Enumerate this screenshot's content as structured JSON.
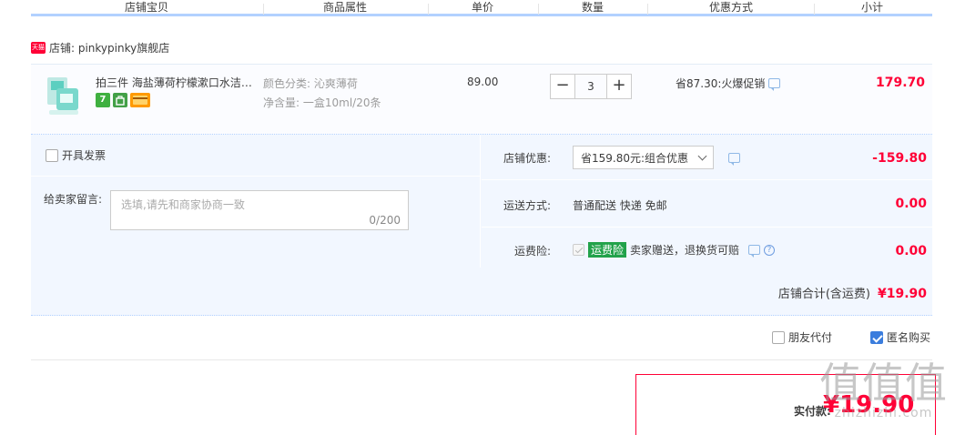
{
  "columns": {
    "shop_item": "店铺宝贝",
    "attributes": "商品属性",
    "unit_price": "单价",
    "quantity": "数量",
    "discount": "优惠方式",
    "subtotal": "小计"
  },
  "shop": {
    "badge": "天猫",
    "label": "店铺: pinkypinky旗舰店"
  },
  "item": {
    "title": "拍三件 海盐薄荷柠檬漱口水洁…",
    "tags": [
      "7",
      "",
      ""
    ],
    "attr_color": "颜色分类: 沁爽薄荷",
    "attr_content": "净含量: 一盒10ml/20条",
    "price": "89.00",
    "quantity": "3",
    "minus": "−",
    "plus": "+",
    "promo": "省87.30:火爆促销",
    "subtotal": "179.70"
  },
  "order": {
    "invoice_label": "开具发票",
    "memo_label": "给卖家留言:",
    "memo_placeholder": "选填,请先和商家协商一致",
    "memo_count": "0/200",
    "shop_discount_label": "店铺优惠:",
    "shop_discount_value": "省159.80元:组合优惠",
    "shop_discount_amount": "-159.80",
    "shipping_label": "运送方式:",
    "shipping_value": "普通配送 快递 免邮",
    "shipping_amount": "0.00",
    "insurance_label": "运费险:",
    "insurance_badge": "运费险",
    "insurance_value": "卖家赠送，退换货可赔",
    "insurance_amount": "0.00",
    "help_mark": "?",
    "total_label": "店铺合计(含运费)",
    "total_value": "¥19.90"
  },
  "options": {
    "friend_pay": "朋友代付",
    "anonymous": "匿名购买",
    "anonymous_checked": true
  },
  "payment": {
    "label": "实付款:",
    "value": "¥19.90"
  },
  "watermark": {
    "glyphs": "值值值",
    "text": "zhizhizhi.com"
  },
  "colors": {
    "accent_red": "#ff0036",
    "header_blue": "#b2d1ff",
    "panel_bg": "#f2f7ff"
  }
}
